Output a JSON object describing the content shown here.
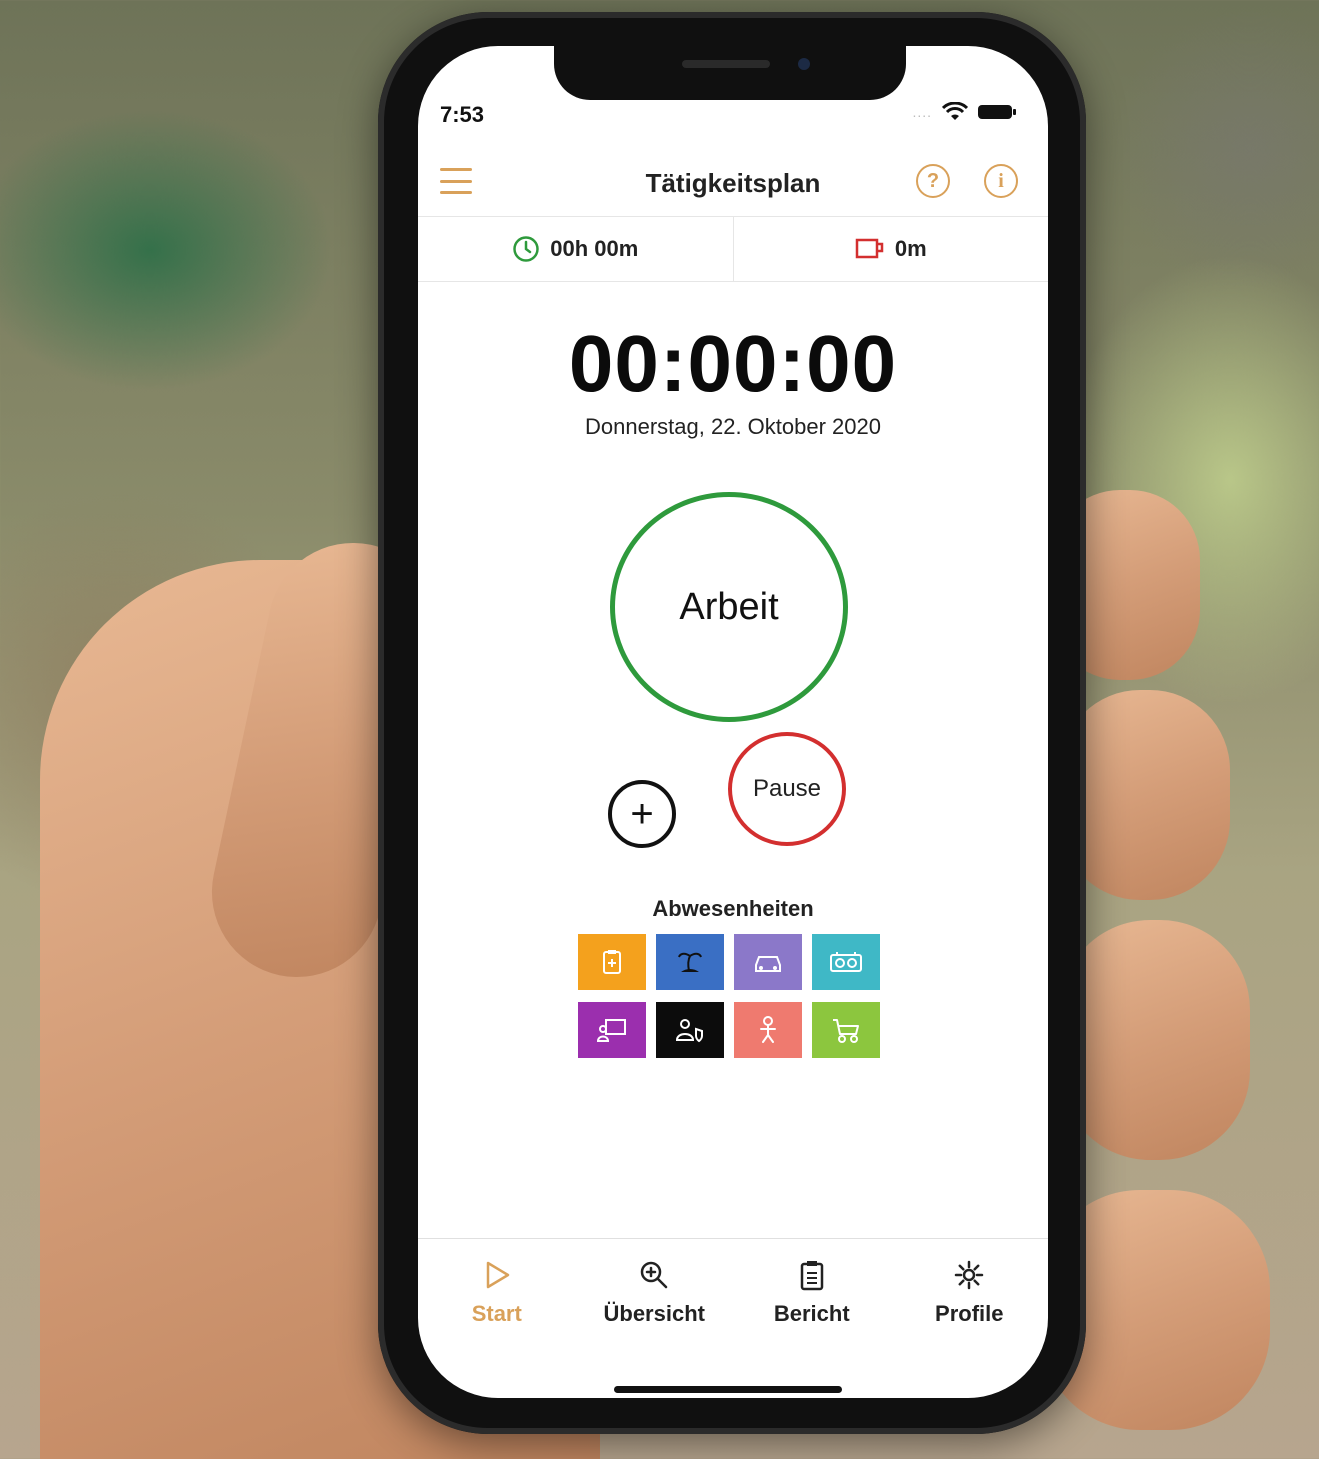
{
  "status_bar": {
    "time": "7:53",
    "signal_dots": "....",
    "icons": [
      "wifi-icon",
      "battery-icon"
    ]
  },
  "header": {
    "title": "Tätigkeitsplan",
    "help_label": "?",
    "info_label": "i",
    "menu_icon": "hamburger-menu-icon"
  },
  "summary": {
    "work_time": "00h 00m",
    "break_time": "0m"
  },
  "timer": {
    "display": "00:00:00",
    "date": "Donnerstag, 22. Oktober 2020"
  },
  "actions": {
    "work_label": "Arbeit",
    "pause_label": "Pause",
    "add_label": "+"
  },
  "absences": {
    "title": "Abwesenheiten",
    "items": [
      {
        "icon": "sick-note-icon",
        "color": "#f4a11d"
      },
      {
        "icon": "vacation-palm-icon",
        "color": "#3a6fc4"
      },
      {
        "icon": "car-icon",
        "color": "#8b78c9"
      },
      {
        "icon": "tape-recorder-icon",
        "color": "#3fb8c6"
      },
      {
        "icon": "training-board-icon",
        "color": "#9b2fae"
      },
      {
        "icon": "person-shield-icon",
        "color": "#0c0c0c"
      },
      {
        "icon": "baby-icon",
        "color": "#ef7a6f"
      },
      {
        "icon": "stroller-icon",
        "color": "#8cc63e"
      }
    ]
  },
  "tabbar": {
    "items": [
      {
        "label": "Start",
        "icon": "play-icon",
        "active": true
      },
      {
        "label": "Übersicht",
        "icon": "zoom-in-icon",
        "active": false
      },
      {
        "label": "Bericht",
        "icon": "clipboard-icon",
        "active": false
      },
      {
        "label": "Profile",
        "icon": "gear-icon",
        "active": false
      }
    ]
  },
  "colors": {
    "accent": "#d9a15a",
    "work_ring": "#2e9a3c",
    "pause_ring": "#d32f2f"
  }
}
